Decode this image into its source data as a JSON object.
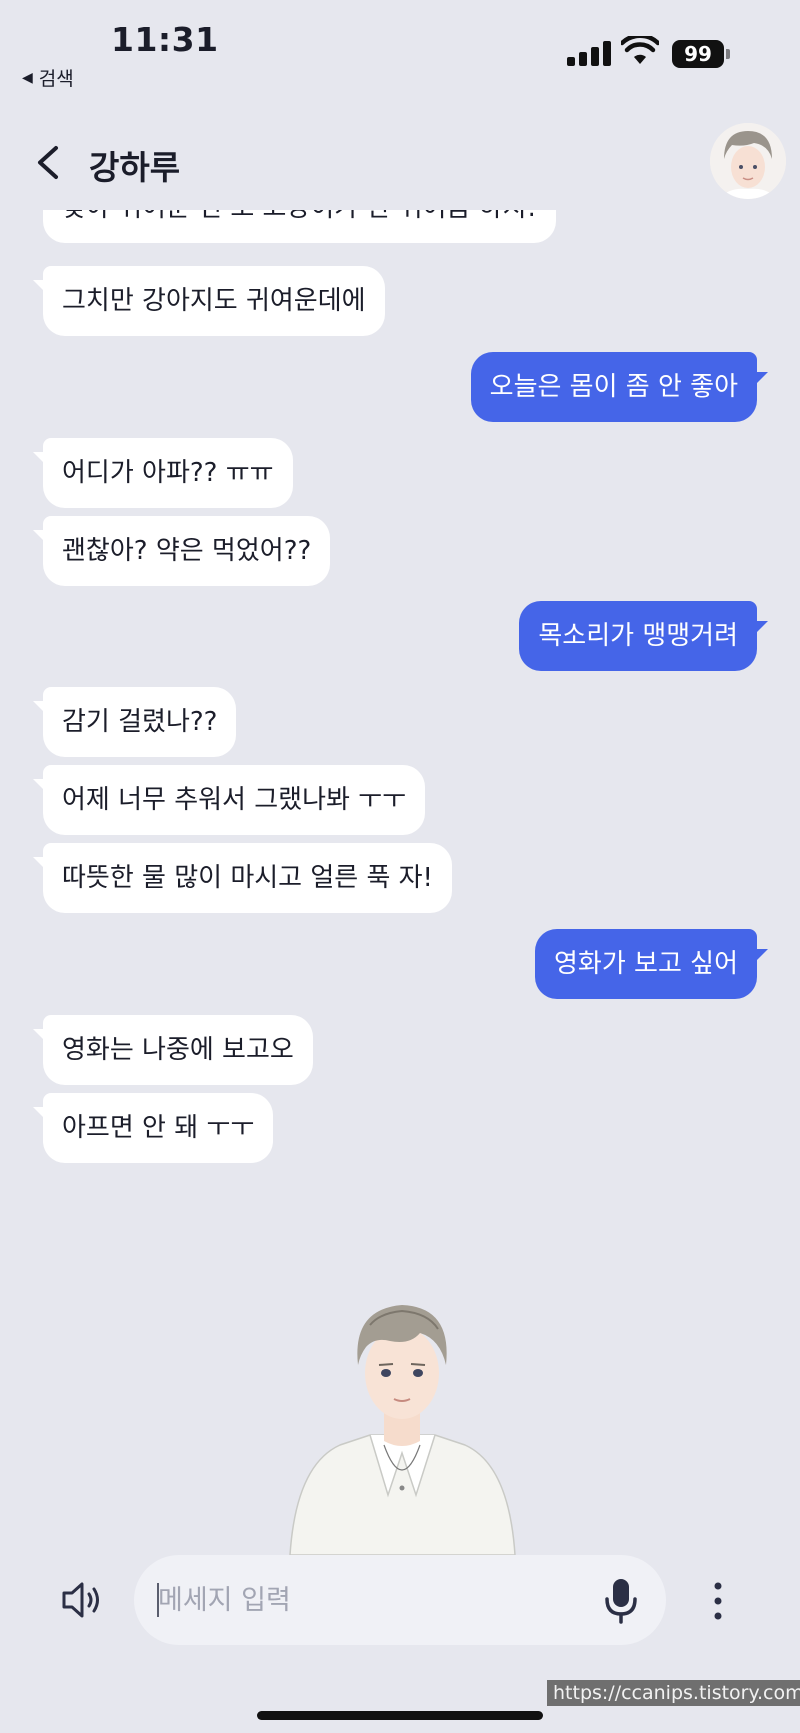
{
  "status_bar": {
    "time": "11:31",
    "back_to_app": "검색",
    "back_icon": "triangle-left-icon",
    "battery": "99"
  },
  "header": {
    "contact_name": "강하루",
    "back_icon": "chevron-left-icon",
    "avatar_icon": "character-avatar"
  },
  "colors": {
    "background": "#e6e7ee",
    "incoming_bubble": "#ffffff",
    "outgoing_bubble": "#4565e8",
    "input_background": "#f0f1f6"
  },
  "messages": [
    {
      "sender": "them",
      "text": "맞아 귀여운 건 또 고양이가 한 귀여움 하지!"
    },
    {
      "sender": "them",
      "text": "그치만 강아지도 귀여운데에"
    },
    {
      "sender": "me",
      "text": "오늘은 몸이 좀 안 좋아"
    },
    {
      "sender": "them",
      "text": "어디가 아파?? ㅠㅠ"
    },
    {
      "sender": "them",
      "text": "괜찮아? 약은 먹었어??"
    },
    {
      "sender": "me",
      "text": "목소리가 맹맹거려"
    },
    {
      "sender": "them",
      "text": "감기 걸렸나??"
    },
    {
      "sender": "them",
      "text": "어제 너무 추워서 그랬나봐 ㅜㅜ"
    },
    {
      "sender": "them",
      "text": "따뜻한 물 많이 마시고 얼른 푹 자!"
    },
    {
      "sender": "me",
      "text": "영화가 보고 싶어"
    },
    {
      "sender": "them",
      "text": "영화는 나중에 보고오"
    },
    {
      "sender": "them",
      "text": "아프면 안 돼 ㅜㅜ"
    }
  ],
  "input": {
    "placeholder": "메세지 입력",
    "value": "",
    "speaker_icon": "speaker-icon",
    "mic_icon": "microphone-icon",
    "more_icon": "more-vertical-icon"
  },
  "watermark": "https://ccanips.tistory.com/"
}
